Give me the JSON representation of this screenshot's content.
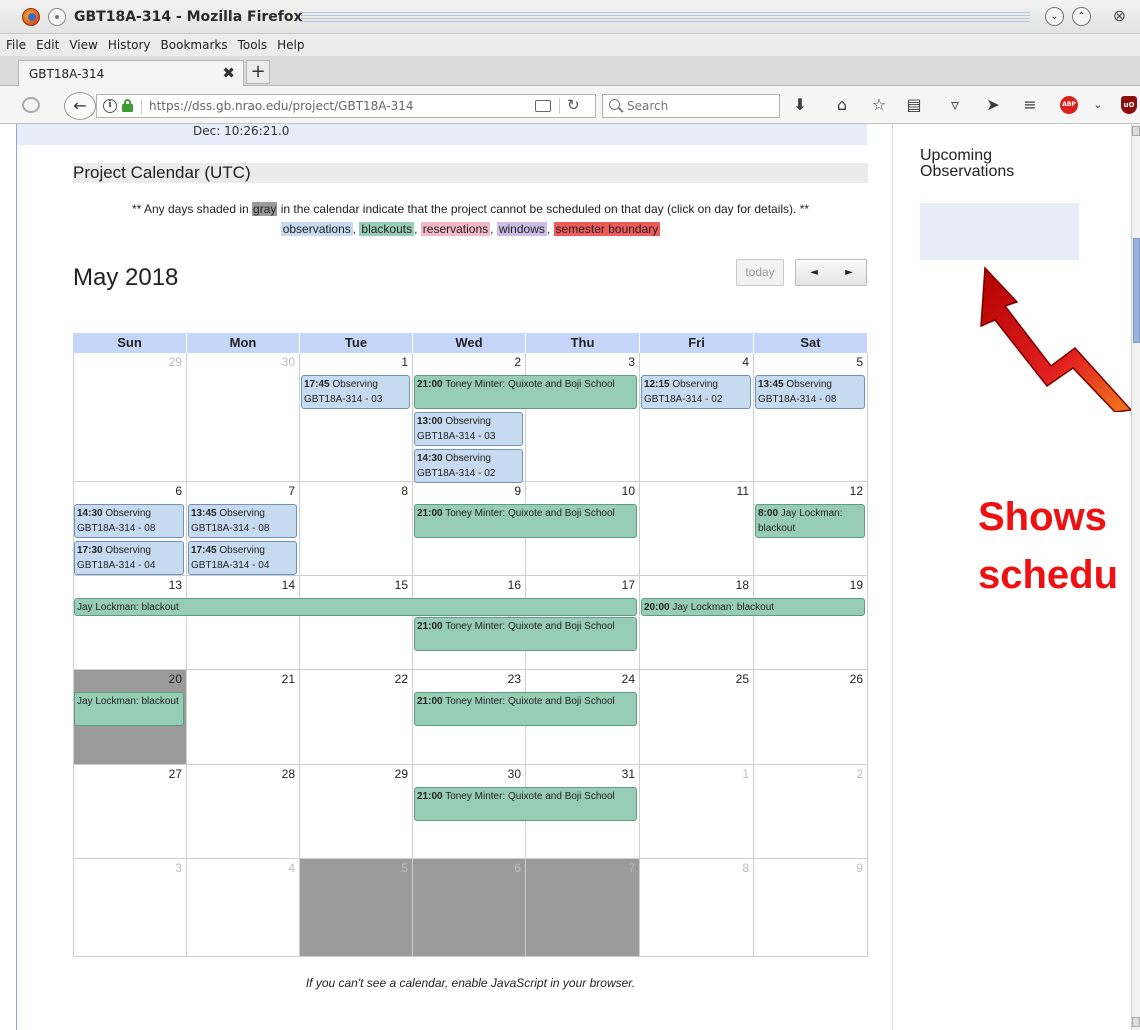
{
  "window": {
    "title": "GBT18A-314 - Mozilla Firefox",
    "min_glyph": "⌄",
    "max_glyph": "⌃",
    "close_glyph": "⊗"
  },
  "menubar": {
    "items": [
      "File",
      "Edit",
      "View",
      "History",
      "Bookmarks",
      "Tools",
      "Help"
    ]
  },
  "tabs": {
    "active_label": "GBT18A-314",
    "close_glyph": "✖",
    "new_tab_glyph": "+"
  },
  "navbar": {
    "back_glyph": "←",
    "url": "https://dss.gb.nrao.edu/project/GBT18A-314",
    "search_placeholder": "Search",
    "reload_glyph": "↻",
    "download_glyph": "⬇",
    "home_glyph": "⌂",
    "bookmark_glyph": "☆",
    "library_glyph": "▤",
    "pocket_glyph": "▿",
    "send_glyph": "➤",
    "menu_glyph": "≡",
    "dropdown_glyph": "⌄",
    "abp_label": "ABP",
    "ublock_label": "uO"
  },
  "page": {
    "dec_text": "Dec: 10:26:21.0",
    "calendar_heading": "Project Calendar (UTC)",
    "note_prefix": "** Any days shaded in ",
    "note_gray": "gray",
    "note_suffix": " in the calendar indicate that the project cannot be scheduled on that day (click on day for details). **",
    "legend": {
      "observations": "observations",
      "blackouts": "blackouts",
      "reservations": "reservations",
      "windows": "windows",
      "semester_boundary": "semester boundary",
      "sep": ", "
    },
    "legend_colors": {
      "observations": "#c7dbf0",
      "blackouts": "#97ccb7",
      "reservations": "#f2b8c6",
      "windows": "#cdbde6",
      "semester_boundary": "#ef5a5a"
    },
    "month_title": "May 2018",
    "today_label": "today",
    "prev_glyph": "◄",
    "next_glyph": "►",
    "days_of_week": [
      "Sun",
      "Mon",
      "Tue",
      "Wed",
      "Thu",
      "Fri",
      "Sat"
    ],
    "weeks": [
      [
        {
          "d": "29",
          "o": true
        },
        {
          "d": "30",
          "o": true
        },
        {
          "d": "1"
        },
        {
          "d": "2"
        },
        {
          "d": "3"
        },
        {
          "d": "4"
        },
        {
          "d": "5"
        }
      ],
      [
        {
          "d": "6"
        },
        {
          "d": "7"
        },
        {
          "d": "8"
        },
        {
          "d": "9"
        },
        {
          "d": "10"
        },
        {
          "d": "11"
        },
        {
          "d": "12"
        }
      ],
      [
        {
          "d": "13"
        },
        {
          "d": "14"
        },
        {
          "d": "15"
        },
        {
          "d": "16"
        },
        {
          "d": "17"
        },
        {
          "d": "18"
        },
        {
          "d": "19"
        }
      ],
      [
        {
          "d": "20",
          "s": true
        },
        {
          "d": "21"
        },
        {
          "d": "22"
        },
        {
          "d": "23"
        },
        {
          "d": "24"
        },
        {
          "d": "25"
        },
        {
          "d": "26"
        }
      ],
      [
        {
          "d": "27"
        },
        {
          "d": "28"
        },
        {
          "d": "29"
        },
        {
          "d": "30"
        },
        {
          "d": "31"
        },
        {
          "d": "1",
          "o": true
        },
        {
          "d": "2",
          "o": true
        }
      ],
      [
        {
          "d": "3",
          "o": true
        },
        {
          "d": "4",
          "o": true
        },
        {
          "d": "5",
          "o": true,
          "s": true
        },
        {
          "d": "6",
          "o": true,
          "s": true
        },
        {
          "d": "7",
          "o": true,
          "s": true
        },
        {
          "d": "8",
          "o": true
        },
        {
          "d": "9",
          "o": true
        }
      ]
    ],
    "events": [
      {
        "week": 0,
        "start": 2,
        "span": 1,
        "row": 0,
        "kind": "obs",
        "time": "17:45",
        "text": "Observing GBT18A-314 - 03"
      },
      {
        "week": 0,
        "start": 3,
        "span": 2,
        "row": 0,
        "kind": "blk",
        "time": "21:00",
        "text": "Toney Minter: Quixote and Boji School"
      },
      {
        "week": 0,
        "start": 3,
        "span": 1,
        "row": 1,
        "kind": "obs",
        "time": "13:00",
        "text": "Observing GBT18A-314 - 03"
      },
      {
        "week": 0,
        "start": 3,
        "span": 1,
        "row": 2,
        "kind": "obs",
        "time": "14:30",
        "text": "Observing GBT18A-314 - 02"
      },
      {
        "week": 0,
        "start": 5,
        "span": 1,
        "row": 0,
        "kind": "obs",
        "time": "12:15",
        "text": "Observing GBT18A-314 - 02"
      },
      {
        "week": 0,
        "start": 6,
        "span": 1,
        "row": 0,
        "kind": "obs",
        "time": "13:45",
        "text": "Observing GBT18A-314 - 08"
      },
      {
        "week": 1,
        "start": 0,
        "span": 1,
        "row": 0,
        "kind": "obs",
        "time": "14:30",
        "text": "Observing GBT18A-314 - 08"
      },
      {
        "week": 1,
        "start": 0,
        "span": 1,
        "row": 1,
        "kind": "obs",
        "time": "17:30",
        "text": "Observing GBT18A-314 - 04"
      },
      {
        "week": 1,
        "start": 1,
        "span": 1,
        "row": 0,
        "kind": "obs",
        "time": "13:45",
        "text": "Observing GBT18A-314 - 08"
      },
      {
        "week": 1,
        "start": 1,
        "span": 1,
        "row": 1,
        "kind": "obs",
        "time": "17:45",
        "text": "Observing GBT18A-314 - 04"
      },
      {
        "week": 1,
        "start": 3,
        "span": 2,
        "row": 0,
        "kind": "blk",
        "time": "21:00",
        "text": "Toney Minter: Quixote and Boji School"
      },
      {
        "week": 1,
        "start": 6,
        "span": 1,
        "row": 0,
        "kind": "blk",
        "time": "8:00",
        "text": "Jay Lockman: blackout"
      },
      {
        "week": 2,
        "start": 0,
        "span": 5,
        "row": 0,
        "kind": "blk",
        "short": true,
        "time": "",
        "text": "Jay Lockman: blackout"
      },
      {
        "week": 2,
        "start": 5,
        "span": 2,
        "row": 0,
        "kind": "blk",
        "short": true,
        "time": "20:00",
        "text": "Jay Lockman: blackout"
      },
      {
        "week": 2,
        "start": 3,
        "span": 2,
        "row": 1,
        "kind": "blk",
        "time": "21:00",
        "text": "Toney Minter: Quixote and Boji School"
      },
      {
        "week": 3,
        "start": 0,
        "span": 1,
        "row": 0,
        "kind": "blk",
        "time": "",
        "text": "Jay Lockman: blackout"
      },
      {
        "week": 3,
        "start": 3,
        "span": 2,
        "row": 0,
        "kind": "blk",
        "time": "21:00",
        "text": "Toney Minter: Quixote and Boji School"
      },
      {
        "week": 4,
        "start": 3,
        "span": 2,
        "row": 0,
        "kind": "blk",
        "time": "21:00",
        "text": "Toney Minter: Quixote and Boji School"
      }
    ],
    "js_note": "If you can't see a calendar, enable JavaScript in your browser.",
    "upcoming_title_line1": "Upcoming",
    "upcoming_title_line2": "Observations"
  },
  "annotation": {
    "line1": "Shows",
    "line2": "schedu",
    "color": "#ee1111"
  }
}
